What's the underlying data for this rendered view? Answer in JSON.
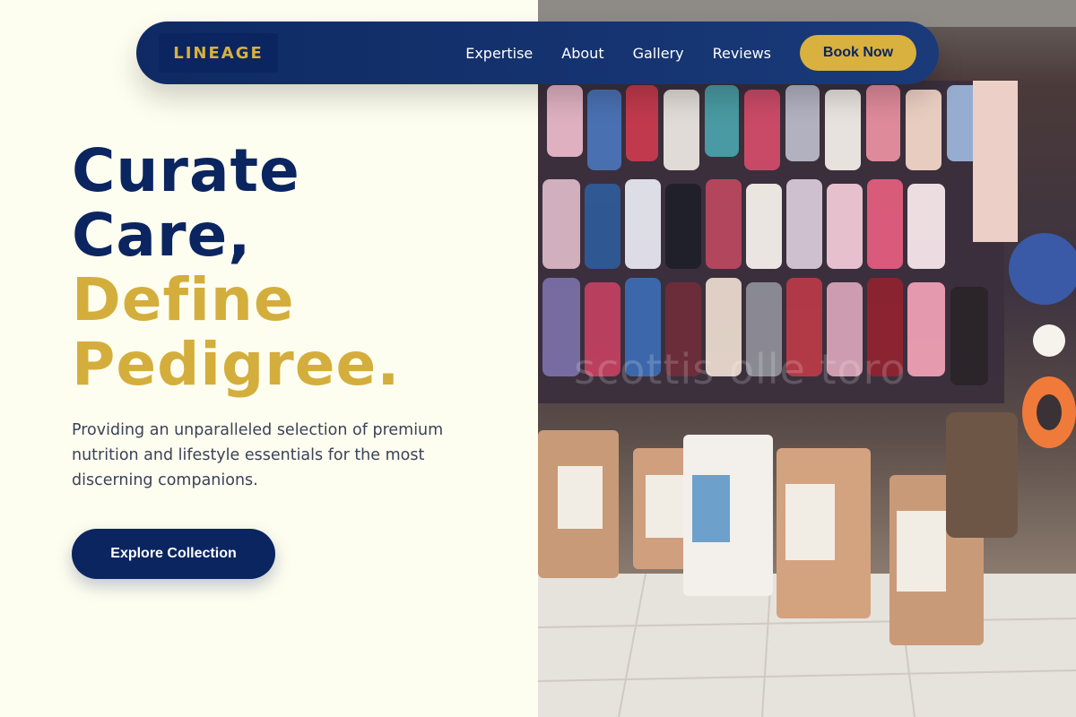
{
  "brand": {
    "logo_text": "LINEAGE",
    "navy": "#0b2560",
    "gold": "#d4ae3c",
    "background": "#fefef0"
  },
  "nav": {
    "links": [
      "Expertise",
      "About",
      "Gallery",
      "Reviews"
    ],
    "cta_label": "Book Now"
  },
  "hero": {
    "headline_line1": "Curate",
    "headline_line2": "Care,",
    "headline_line3": "Define",
    "headline_line4": "Pedigree.",
    "description": "Providing an unparalleled selection of premium nutrition and lifestyle essentials for the most discerning companions.",
    "cta_label": "Explore Collection",
    "image_watermark": "scottis olle toro"
  }
}
